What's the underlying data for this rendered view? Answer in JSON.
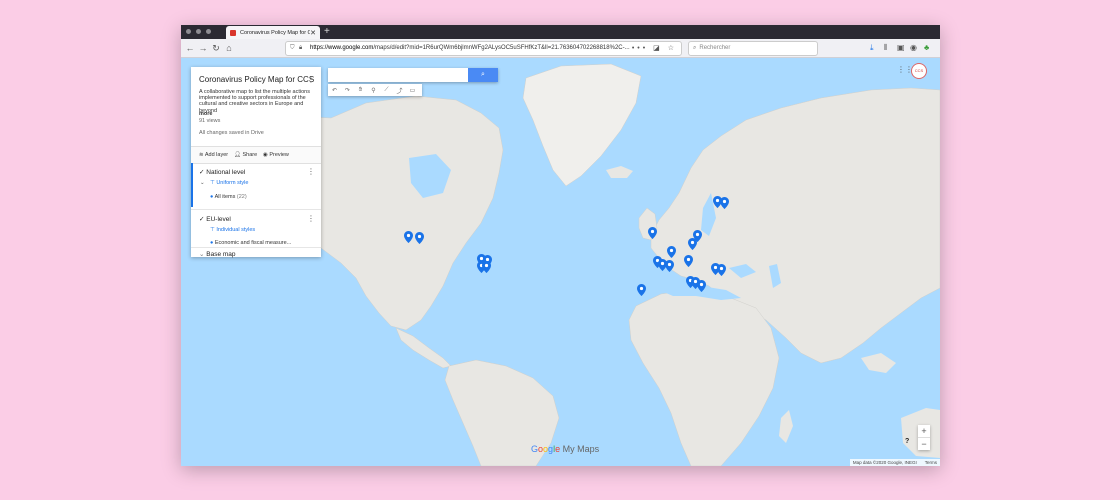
{
  "browser": {
    "tab_title": "Coronavirus Policy Map for CCS",
    "tab_close": "✕",
    "new_tab": "+",
    "url_domain": "https://www.google.com",
    "url_path": "/maps/d/edit?mid=1R6urQWm6bjlmnWFg2ALysOC5uSFHfKzT&ll=21.763604702268818%2C-...",
    "search_placeholder": "Rechercher"
  },
  "panel": {
    "title": "Coronavirus Policy Map for CCS",
    "description": "A collaborative map to list the multiple actions implemented to support professionals of the cultural and creative sectors in Europe and beyond",
    "more": "more",
    "views": "91 views",
    "saved": "All changes saved in Drive",
    "add_layer": "Add layer",
    "share": "Share",
    "preview": "Preview",
    "layers": [
      {
        "name": "National level",
        "style": "Uniform style",
        "items_label": "All items",
        "items_count": "(22)"
      },
      {
        "name": "EU-level",
        "style": "Individual styles",
        "item": "Economic and fiscal measure..."
      }
    ],
    "base_map": "Base map"
  },
  "map": {
    "brand": "My Maps",
    "attribution": "Map data ©2020 Google, INEGI",
    "terms": "Terms",
    "zoom_in": "+",
    "zoom_out": "−",
    "help": "?",
    "logo_text": "CCS"
  },
  "colors": {
    "land": "#e8e7e3",
    "water": "#aadaff",
    "marker": "#1a73e8",
    "accent": "#1a73e8"
  }
}
